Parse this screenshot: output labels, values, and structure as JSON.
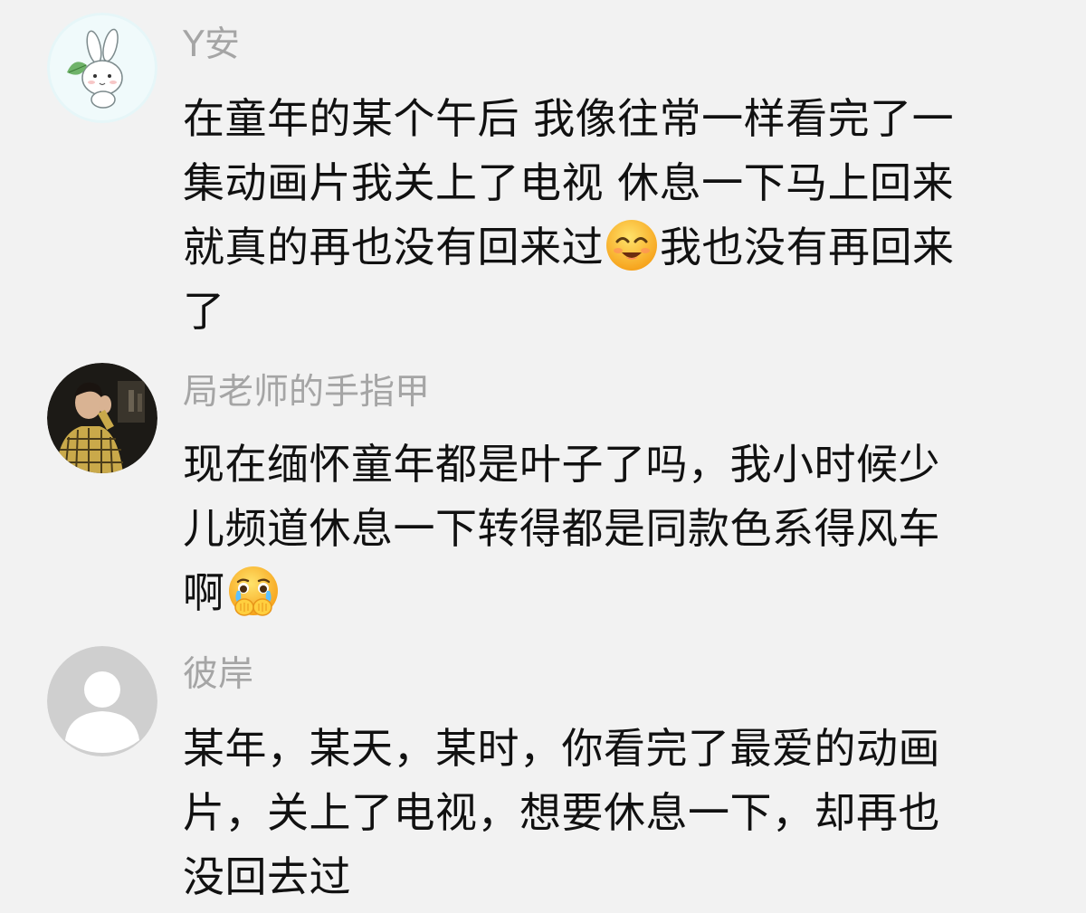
{
  "comments": [
    {
      "username": "Y安",
      "avatar": "bunny-avatar",
      "lines": [
        {
          "a": "在童年的某个午后 我像往常一样看完了一",
          "b": ""
        },
        {
          "a": "集动画片我关上了电视 休息一下马上回来",
          "b": ""
        },
        {
          "a": "就真的再也没有回来过",
          "b": "我也没有再回来"
        },
        {
          "a": "了",
          "b": ""
        }
      ],
      "emoji": "smiling-face-emoji"
    },
    {
      "username": "局老师的手指甲",
      "avatar": "man-plaid-jacket-avatar",
      "lines": [
        {
          "a": "现在缅怀童年都是叶子了吗，我小时候少"
        },
        {
          "a": "儿频道休息一下转得都是同款色系得风车"
        },
        {
          "a": "啊"
        }
      ],
      "emoji": "crying-hands-emoji"
    },
    {
      "username": "彼岸",
      "avatar": "default-user-avatar",
      "lines": [
        {
          "a": "某年，某天，某时，你看完了最爱的动画"
        },
        {
          "a": "片，关上了电视，想要休息一下，却再也"
        },
        {
          "a": "没回去过"
        }
      ]
    }
  ],
  "colors": {
    "background": "#f2f2f2",
    "username": "#a5a5a5",
    "text": "#111111"
  }
}
